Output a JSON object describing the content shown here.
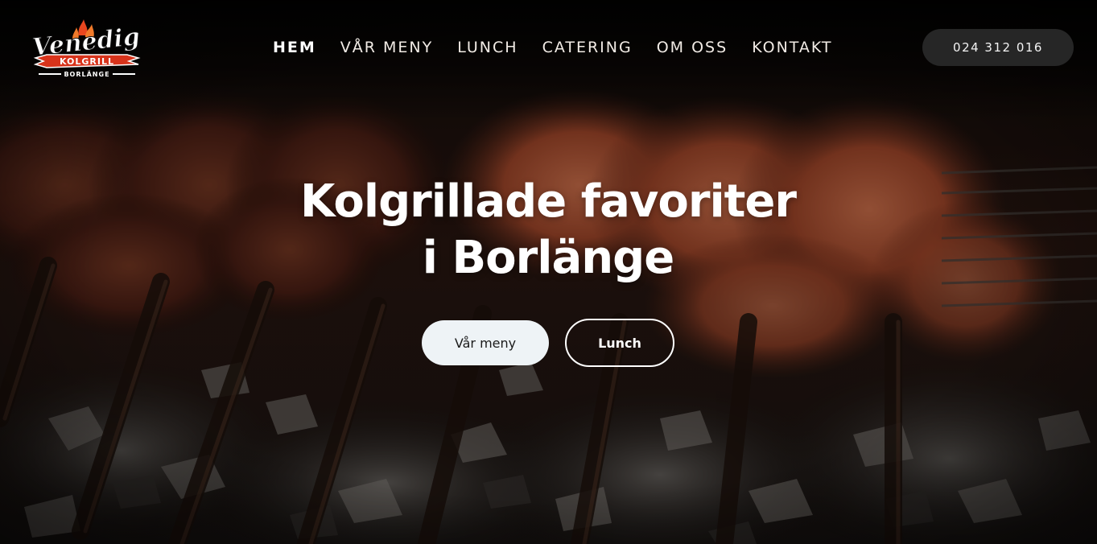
{
  "brand": {
    "logo_script": "Venedig",
    "logo_banner": "KOLGRILL",
    "logo_city": "BORLÄNGE",
    "logo_flame_color": "#e8461f",
    "logo_banner_color": "#d8331b"
  },
  "nav": {
    "items": [
      {
        "label": "HEM",
        "active": true
      },
      {
        "label": "VÅR MENY",
        "active": false
      },
      {
        "label": "LUNCH",
        "active": false
      },
      {
        "label": "CATERING",
        "active": false
      },
      {
        "label": "OM OSS",
        "active": false
      },
      {
        "label": "KONTAKT",
        "active": false
      }
    ]
  },
  "header": {
    "phone_label": "024 312 016"
  },
  "hero": {
    "title_line1": "Kolgrillade favoriter",
    "title_line2": "i Borlänge",
    "primary_cta": "Vår meny",
    "secondary_cta": "Lunch",
    "background_image": "charcoal-grilled-skewers-photo"
  },
  "colors": {
    "header_pill_bg": "#262626",
    "primary_cta_bg": "#eef3f6",
    "text_light": "#ffffff"
  }
}
